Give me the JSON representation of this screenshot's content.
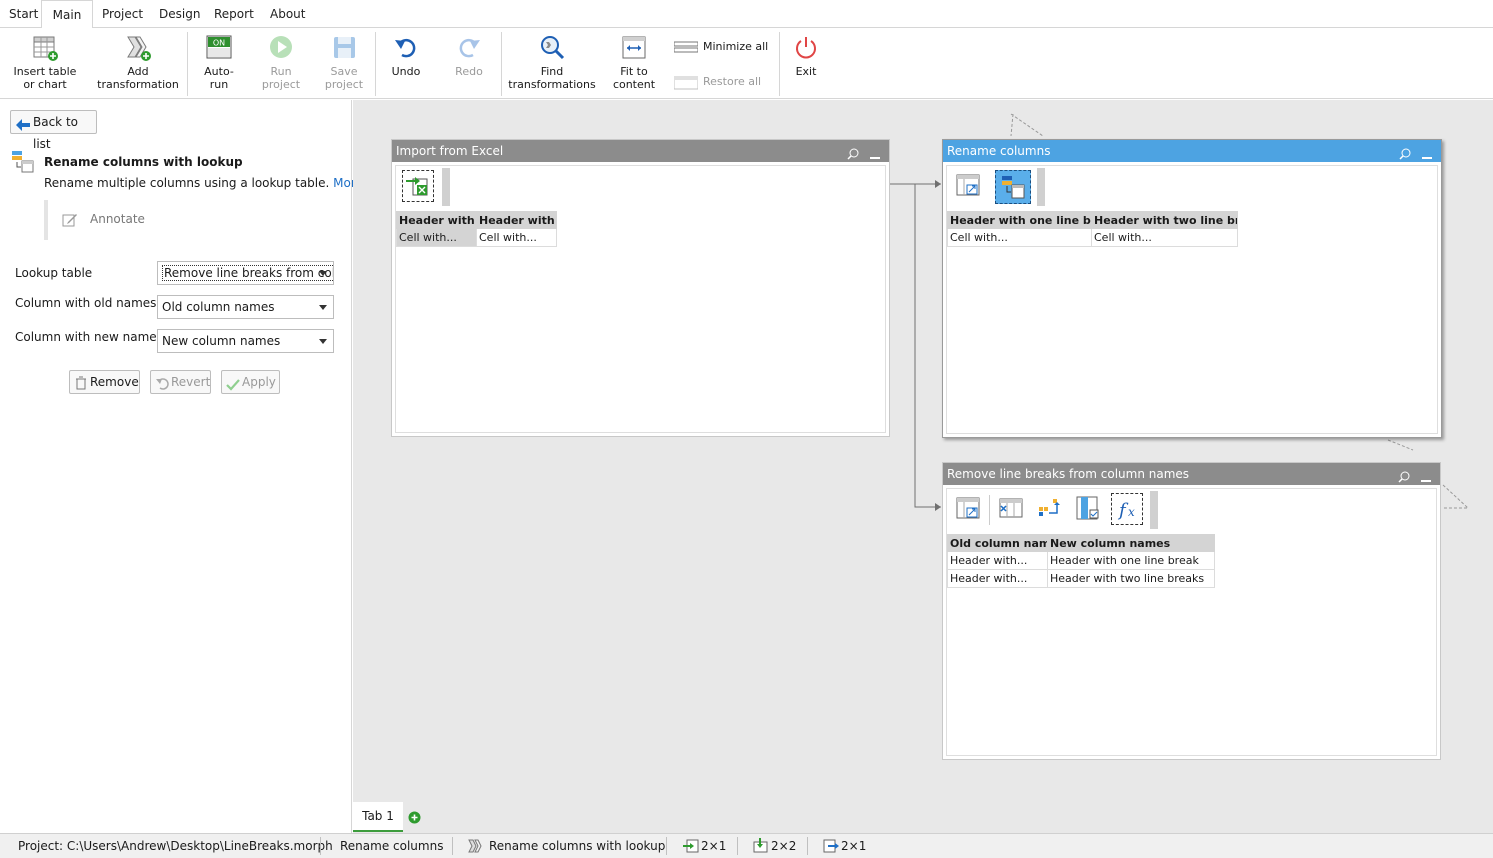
{
  "menu": {
    "tabs": [
      "Start",
      "Main",
      "Project",
      "Design",
      "Report",
      "About"
    ],
    "active": "Main"
  },
  "ribbon": {
    "insert_table": "Insert table\nor chart",
    "add_transformation": "Add\ntransformation",
    "auto_run": "Auto-\nrun",
    "auto_run_badge": "ON",
    "run_project": "Run\nproject",
    "save_project": "Save\nproject",
    "undo": "Undo",
    "redo": "Redo",
    "find_transformations": "Find\ntransformations",
    "fit_to_content": "Fit to\ncontent",
    "minimize_all": "Minimize all",
    "restore_all": "Restore all",
    "exit": "Exit"
  },
  "left": {
    "back_to_list": "Back to list",
    "title": "Rename columns with lookup",
    "description": "Rename multiple columns using a lookup table.",
    "more_link": "More",
    "annotate": "Annotate",
    "lookup_table_label": "Lookup table",
    "lookup_table_value": "Remove line breaks from col",
    "old_names_label": "Column with old names",
    "old_names_value": "Old column names",
    "new_names_label": "Column with new names",
    "new_names_value": "New column names",
    "remove": "Remove",
    "revert": "Revert",
    "apply": "Apply"
  },
  "nodes": {
    "import": {
      "title": "Import from Excel",
      "headers": [
        "Header with",
        "Header with"
      ],
      "rows": [
        [
          "Cell with...",
          "Cell with..."
        ]
      ]
    },
    "rename": {
      "title": "Rename columns",
      "headers": [
        "Header with one line break",
        "Header with two line breaks"
      ],
      "rows": [
        [
          "Cell with...",
          "Cell with..."
        ]
      ]
    },
    "linebreaks": {
      "title": "Remove line breaks from column names",
      "headers": [
        "Old column names",
        "New column names"
      ],
      "rows": [
        [
          "Header with...",
          "Header with one line break"
        ],
        [
          "Header with...",
          "Header with two line breaks"
        ]
      ]
    }
  },
  "canvas_tabs": {
    "tab1": "Tab 1"
  },
  "status": {
    "project": "Project: C:\\Users\\Andrew\\Desktop\\LineBreaks.morph",
    "dataset": "Rename columns",
    "transformation": "Rename columns with lookup",
    "dim_in": "2×1",
    "dim_lookup": "2×2",
    "dim_out": "2×1"
  },
  "colors": {
    "accent_blue": "#4da3e2",
    "node_header_gray": "#8c8c8c",
    "canvas_bg": "#e8e8e8",
    "link_blue": "#1e6fc6",
    "green": "#2e9b2e",
    "exit_red": "#e04545"
  }
}
